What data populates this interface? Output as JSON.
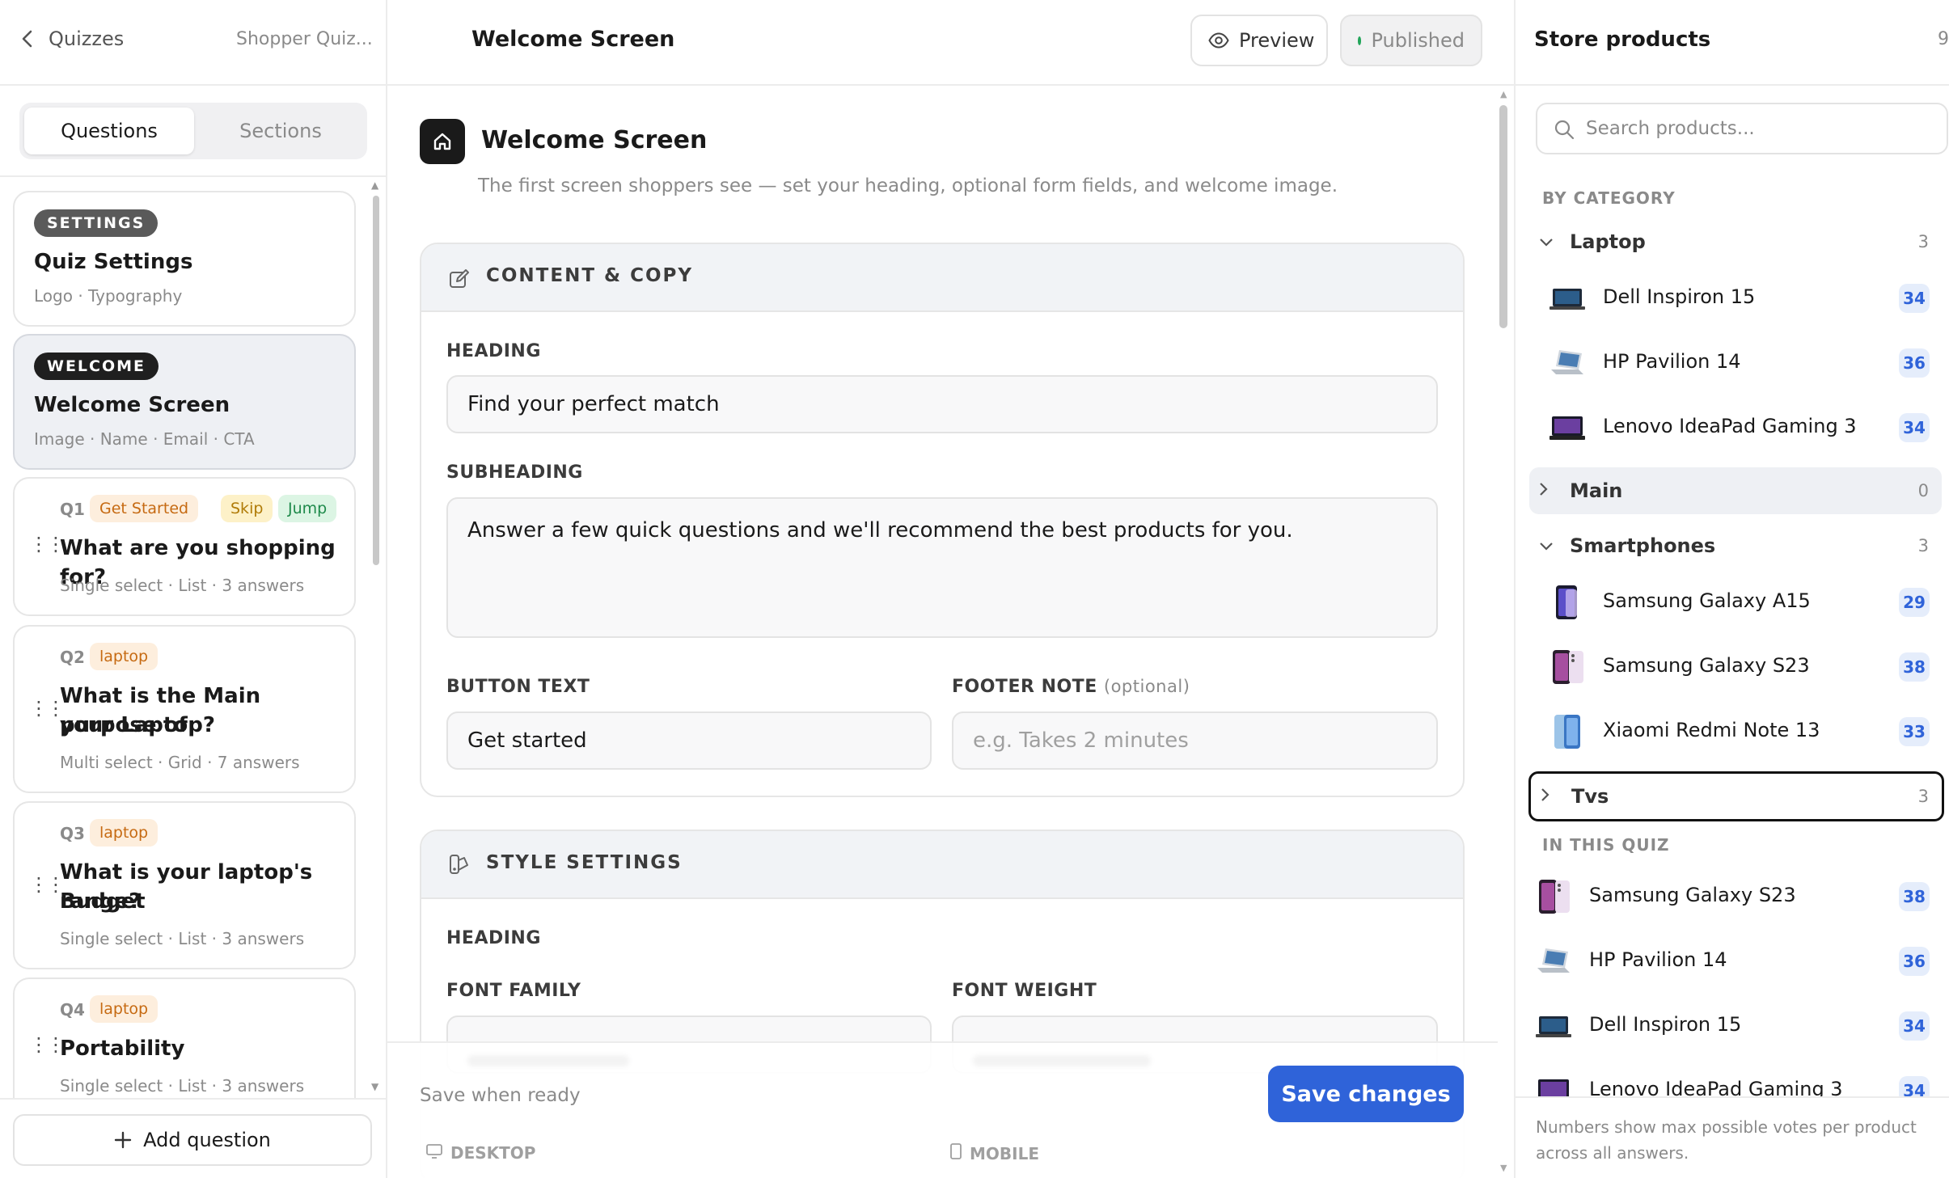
{
  "left": {
    "back_label": "Quizzes",
    "quiz_name": "Shopper Quiz...",
    "tabs": [
      "Questions",
      "Sections"
    ],
    "cards": [
      {
        "pill": "SETTINGS",
        "title": "Quiz Settings",
        "sub": "Logo · Typography"
      },
      {
        "pill": "WELCOME",
        "title": "Welcome Screen",
        "sub": "Image · Name · Email · CTA"
      }
    ],
    "questions": [
      {
        "num": "Q1",
        "tags": [
          "Get Started",
          "Skip",
          "Jump"
        ],
        "title": "What are you shopping for?",
        "title2": "",
        "sub": "Single select · List · 3 answers"
      },
      {
        "num": "Q2",
        "tags": [
          "laptop"
        ],
        "title": "What is the Main purpose of",
        "title2": "your Laptop?",
        "sub": "Multi select · Grid · 7 answers"
      },
      {
        "num": "Q3",
        "tags": [
          "laptop"
        ],
        "title": "What is your laptop's Budget",
        "title2": "range?",
        "sub": "Single select · List · 3 answers"
      },
      {
        "num": "Q4",
        "tags": [
          "laptop"
        ],
        "title": "Portability",
        "title2": "",
        "sub": "Single select · List · 3 answers"
      }
    ],
    "add_question": "Add question"
  },
  "center": {
    "header_title": "Welcome Screen",
    "preview_label": "Preview",
    "published_label": "Published",
    "page_title": "Welcome Screen",
    "page_desc": "The first screen shoppers see — set your heading, optional form fields, and welcome image.",
    "content": {
      "title": "CONTENT & COPY",
      "heading_label": "HEADING",
      "heading_value": "Find your perfect match",
      "subheading_label": "SUBHEADING",
      "subheading_value": "Answer a few quick questions and we'll recommend the best products for you.",
      "button_label": "BUTTON TEXT",
      "button_value": "Get started",
      "footer_label": "FOOTER NOTE",
      "footer_optional": "(optional)",
      "footer_placeholder": "e.g. Takes 2 minutes"
    },
    "style": {
      "title": "STYLE SETTINGS",
      "heading_label": "HEADING",
      "font_family_label": "FONT FAMILY",
      "font_weight_label": "FONT WEIGHT",
      "desktop_label": "DESKTOP",
      "mobile_label": "MOBILE"
    },
    "footer_status": "Save when ready",
    "save_label": "Save changes"
  },
  "right": {
    "title": "Store products",
    "title_count": "9",
    "search_placeholder": "Search products...",
    "by_category": "BY CATEGORY",
    "categories": [
      {
        "name": "Laptop",
        "count": "3",
        "expanded": true,
        "products": [
          {
            "name": "Dell Inspiron 15",
            "votes": "34"
          },
          {
            "name": "HP Pavilion 14",
            "votes": "36"
          },
          {
            "name": "Lenovo IdeaPad Gaming 3",
            "votes": "34"
          }
        ]
      },
      {
        "name": "Main",
        "count": "0",
        "expanded": false,
        "products": []
      },
      {
        "name": "Smartphones",
        "count": "3",
        "expanded": true,
        "products": [
          {
            "name": "Samsung Galaxy A15",
            "votes": "29"
          },
          {
            "name": "Samsung Galaxy S23",
            "votes": "38"
          },
          {
            "name": "Xiaomi Redmi Note 13",
            "votes": "33"
          }
        ]
      },
      {
        "name": "Tvs",
        "count": "3",
        "expanded": false,
        "products": []
      }
    ],
    "in_this_quiz": "IN THIS QUIZ",
    "quiz_products": [
      {
        "name": "Samsung Galaxy S23",
        "votes": "38"
      },
      {
        "name": "HP Pavilion 14",
        "votes": "36"
      },
      {
        "name": "Dell Inspiron 15",
        "votes": "34"
      },
      {
        "name": "Lenovo IdeaPad Gaming 3",
        "votes": "34"
      }
    ],
    "footnote": "Numbers show max possible votes per product across all answers."
  },
  "colors": {
    "accent": "#2f63d9",
    "published_dot": "#22a55a",
    "pill_dark": "#1f1f1f",
    "pill_settings": "#5a5a5a",
    "tag_orange": "#c66a12",
    "tag_green": "#1e8a4b"
  }
}
